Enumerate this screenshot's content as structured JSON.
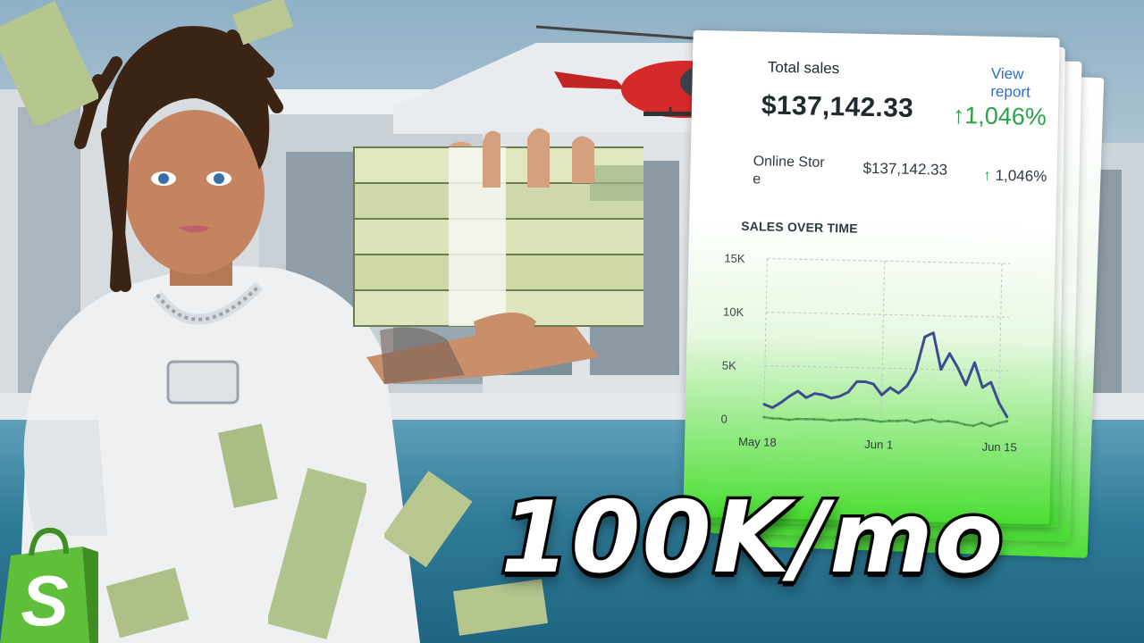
{
  "thumbnail": {
    "headline": "100K/mo",
    "brand_logo": "shopify-bag-logo",
    "logo_text": "S"
  },
  "sales_card": {
    "total_sales_label": "Total sales",
    "view_report_label": "View report",
    "total_amount": "$137,142.33",
    "total_growth": "1,046%",
    "growth_arrow": "↑",
    "channel_label": "Online Store",
    "channel_amount": "$137,142.33",
    "channel_growth": "1,046%",
    "chart_title": "SALES OVER TIME",
    "growth_color": "#2aa34a",
    "link_color": "#2c6ecb"
  },
  "chart_data": {
    "type": "line",
    "title": "SALES OVER TIME",
    "x": [
      "May 18",
      "May 19",
      "May 20",
      "May 21",
      "May 22",
      "May 23",
      "May 24",
      "May 25",
      "May 26",
      "May 27",
      "May 28",
      "May 29",
      "May 30",
      "May 31",
      "Jun 1",
      "Jun 2",
      "Jun 3",
      "Jun 4",
      "Jun 5",
      "Jun 6",
      "Jun 7",
      "Jun 8",
      "Jun 9",
      "Jun 10",
      "Jun 11",
      "Jun 12",
      "Jun 13",
      "Jun 14",
      "Jun 15",
      "Jun 16"
    ],
    "x_tick_labels": [
      "May 18",
      "Jun 1",
      "Jun 15"
    ],
    "y_tick_labels": [
      "0",
      "5K",
      "10K",
      "15K"
    ],
    "ylim": [
      0,
      15000
    ],
    "grid": true,
    "series": [
      {
        "color": "#3d4d8f",
        "values": [
          1400,
          1100,
          1600,
          2200,
          2700,
          2100,
          2500,
          2400,
          2100,
          2300,
          2700,
          3700,
          3700,
          3500,
          2500,
          3200,
          2700,
          3400,
          4800,
          8000,
          8400,
          5000,
          6500,
          5200,
          3600,
          5700,
          3400,
          3900,
          2000,
          700
        ]
      },
      {
        "color": "#3d8f3d",
        "values": [
          200,
          100,
          100,
          0,
          100,
          100,
          100,
          100,
          0,
          100,
          100,
          200,
          200,
          100,
          0,
          100,
          100,
          200,
          0,
          200,
          300,
          100,
          200,
          100,
          -100,
          -200,
          100,
          -200,
          100,
          300
        ]
      }
    ]
  }
}
